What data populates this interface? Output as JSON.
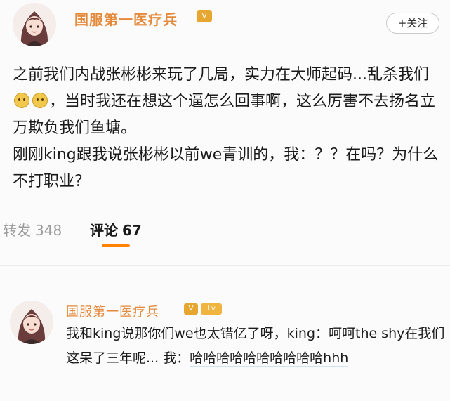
{
  "post": {
    "username": "国服第一医疗兵",
    "follow_button": "+关注",
    "text": {
      "p1_a": "之前我们内战张彬彬来玩了几局，实力在大师起码...乱杀我们",
      "p1_b": "，当时我还在想这个逼怎么回事啊，这么厉害不去扬名立万欺负我们鱼塘。",
      "p2": "刚刚king跟我说张彬彬以前we青训的，我：？？在吗？为什么不打职业？"
    }
  },
  "stats": {
    "repost_label": "转发",
    "repost_count": "348",
    "comment_label": "评论",
    "comment_count": "67"
  },
  "comment": {
    "username": "国服第一医疗兵",
    "text": {
      "line_a": "我和king说那你们we也太错亿了呀，king：呵呵the shy在我们这呆了三年呢... 我：",
      "laugh": "哈哈哈哈哈哈哈哈哈哈hhh"
    }
  },
  "icons": {
    "emoji": "sweat-smile-emoji",
    "badge": "vip-badge"
  },
  "colors": {
    "username": "#e5893a",
    "tab_underline": "#ff8200"
  }
}
